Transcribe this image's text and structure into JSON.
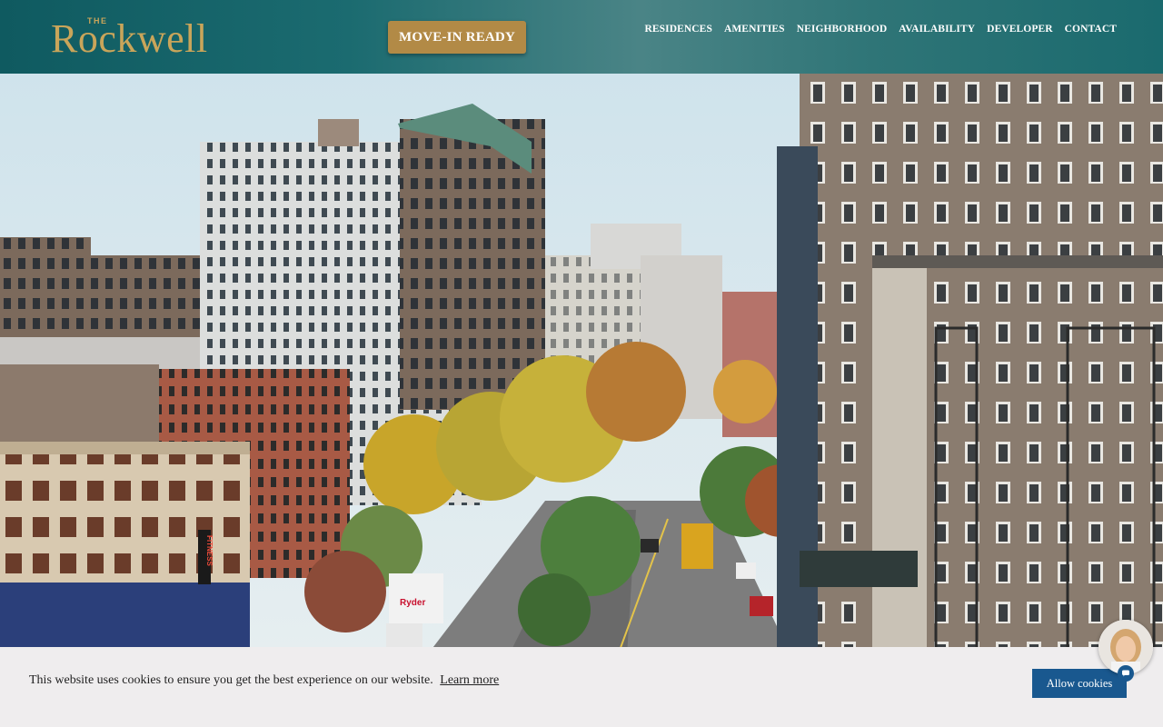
{
  "brand": {
    "small": "THE",
    "name": "Rockwell"
  },
  "header": {
    "cta_label": "MOVE-IN READY"
  },
  "nav": {
    "items": [
      {
        "label": "RESIDENCES"
      },
      {
        "label": "AMENITIES"
      },
      {
        "label": "NEIGHBORHOOD"
      },
      {
        "label": "AVAILABILITY"
      },
      {
        "label": "DEVELOPER"
      },
      {
        "label": "CONTACT"
      }
    ]
  },
  "hero": {
    "signs": {
      "fitness": "FITNESS",
      "truck": "Ryder"
    }
  },
  "cookie": {
    "message": "This website uses cookies to ensure you get the best experience on our website.",
    "learn_more": "Learn more",
    "allow_label": "Allow cookies"
  },
  "colors": {
    "header_teal": "#1b6b70",
    "gold": "#b28a46",
    "cookie_bg": "#efedee",
    "allow_blue": "#19588f"
  },
  "icons": {
    "chat": "chat-bubble-icon",
    "avatar": "agent-avatar"
  }
}
